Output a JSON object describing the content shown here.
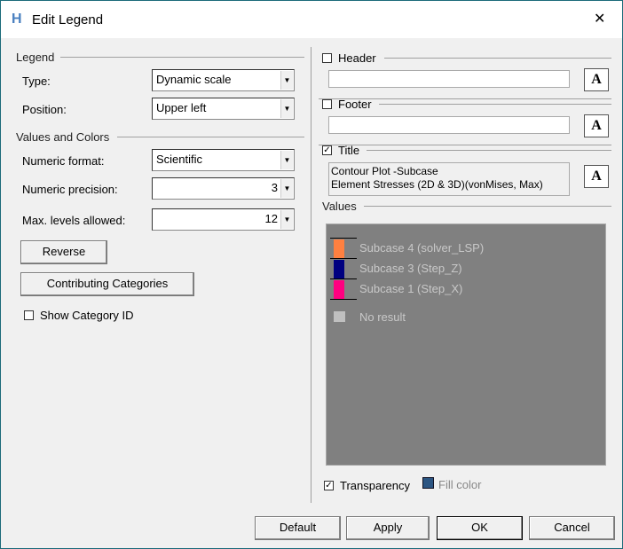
{
  "window": {
    "title": "Edit Legend",
    "close": "✕"
  },
  "legend": {
    "group": "Legend",
    "type_label": "Type:",
    "type_value": "Dynamic scale",
    "position_label": "Position:",
    "position_value": "Upper left"
  },
  "values_colors": {
    "group": "Values and Colors",
    "format_label": "Numeric format:",
    "format_value": "Scientific",
    "precision_label": "Numeric precision:",
    "precision_value": "3",
    "max_label": "Max. levels allowed:",
    "max_value": "12",
    "reverse": "Reverse",
    "contributing": "Contributing Categories",
    "show_id": "Show Category ID"
  },
  "header": {
    "label": "Header",
    "checked": false,
    "value": ""
  },
  "footer": {
    "label": "Footer",
    "checked": false,
    "value": ""
  },
  "title": {
    "label": "Title",
    "checked": true,
    "line1": "Contour Plot -Subcase",
    "line2": "Element Stresses (2D & 3D)(vonMises, Max)"
  },
  "font_button": "A",
  "values": {
    "group": "Values",
    "items": [
      {
        "label": "Subcase 4 (solver_LSP)",
        "color": "#ff8040"
      },
      {
        "label": "Subcase 3 (Step_Z)",
        "color": "#000080"
      },
      {
        "label": "Subcase 1 (Step_X)",
        "color": "#ff0080"
      }
    ],
    "no_result": "No result",
    "no_result_color": "#c0c0c0",
    "bg": "#808080"
  },
  "transparency": {
    "label": "Transparency",
    "checked": true
  },
  "fill_color": {
    "label": "Fill color",
    "color": "#2b5582"
  },
  "buttons": {
    "default": "Default",
    "apply": "Apply",
    "ok": "OK",
    "cancel": "Cancel"
  }
}
